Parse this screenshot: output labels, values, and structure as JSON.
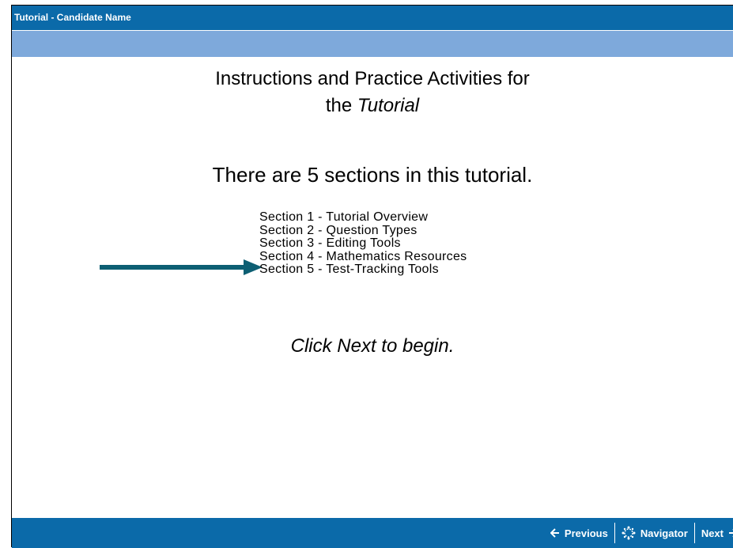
{
  "window": {
    "title": "Tutorial - Candidate Name"
  },
  "main": {
    "heading_line1": "Instructions and Practice Activities for",
    "heading_line2_prefix": "the ",
    "heading_line2_italic": "Tutorial",
    "sections_intro": "There are 5 sections in this tutorial.",
    "sections": [
      "Section 1 - Tutorial Overview",
      "Section 2 - Question Types",
      "Section 3 - Editing Tools",
      "Section 4 - Mathematics Resources",
      "Section 5 - Test-Tracking Tools"
    ],
    "highlighted_section_index": 3,
    "call_to_action": "Click Next to begin."
  },
  "footer": {
    "previous_label": "Previous",
    "navigator_label": "Navigator",
    "next_label": "Next"
  },
  "icons": {
    "previous": "arrow-left-icon",
    "navigator": "navigator-icon",
    "next": "arrow-right-icon",
    "pointer": "pointer-arrow-icon"
  },
  "colors": {
    "title_bar": "#0b6aa9",
    "sub_bar": "#7ea9db",
    "pointer_arrow": "#0d5f73"
  }
}
